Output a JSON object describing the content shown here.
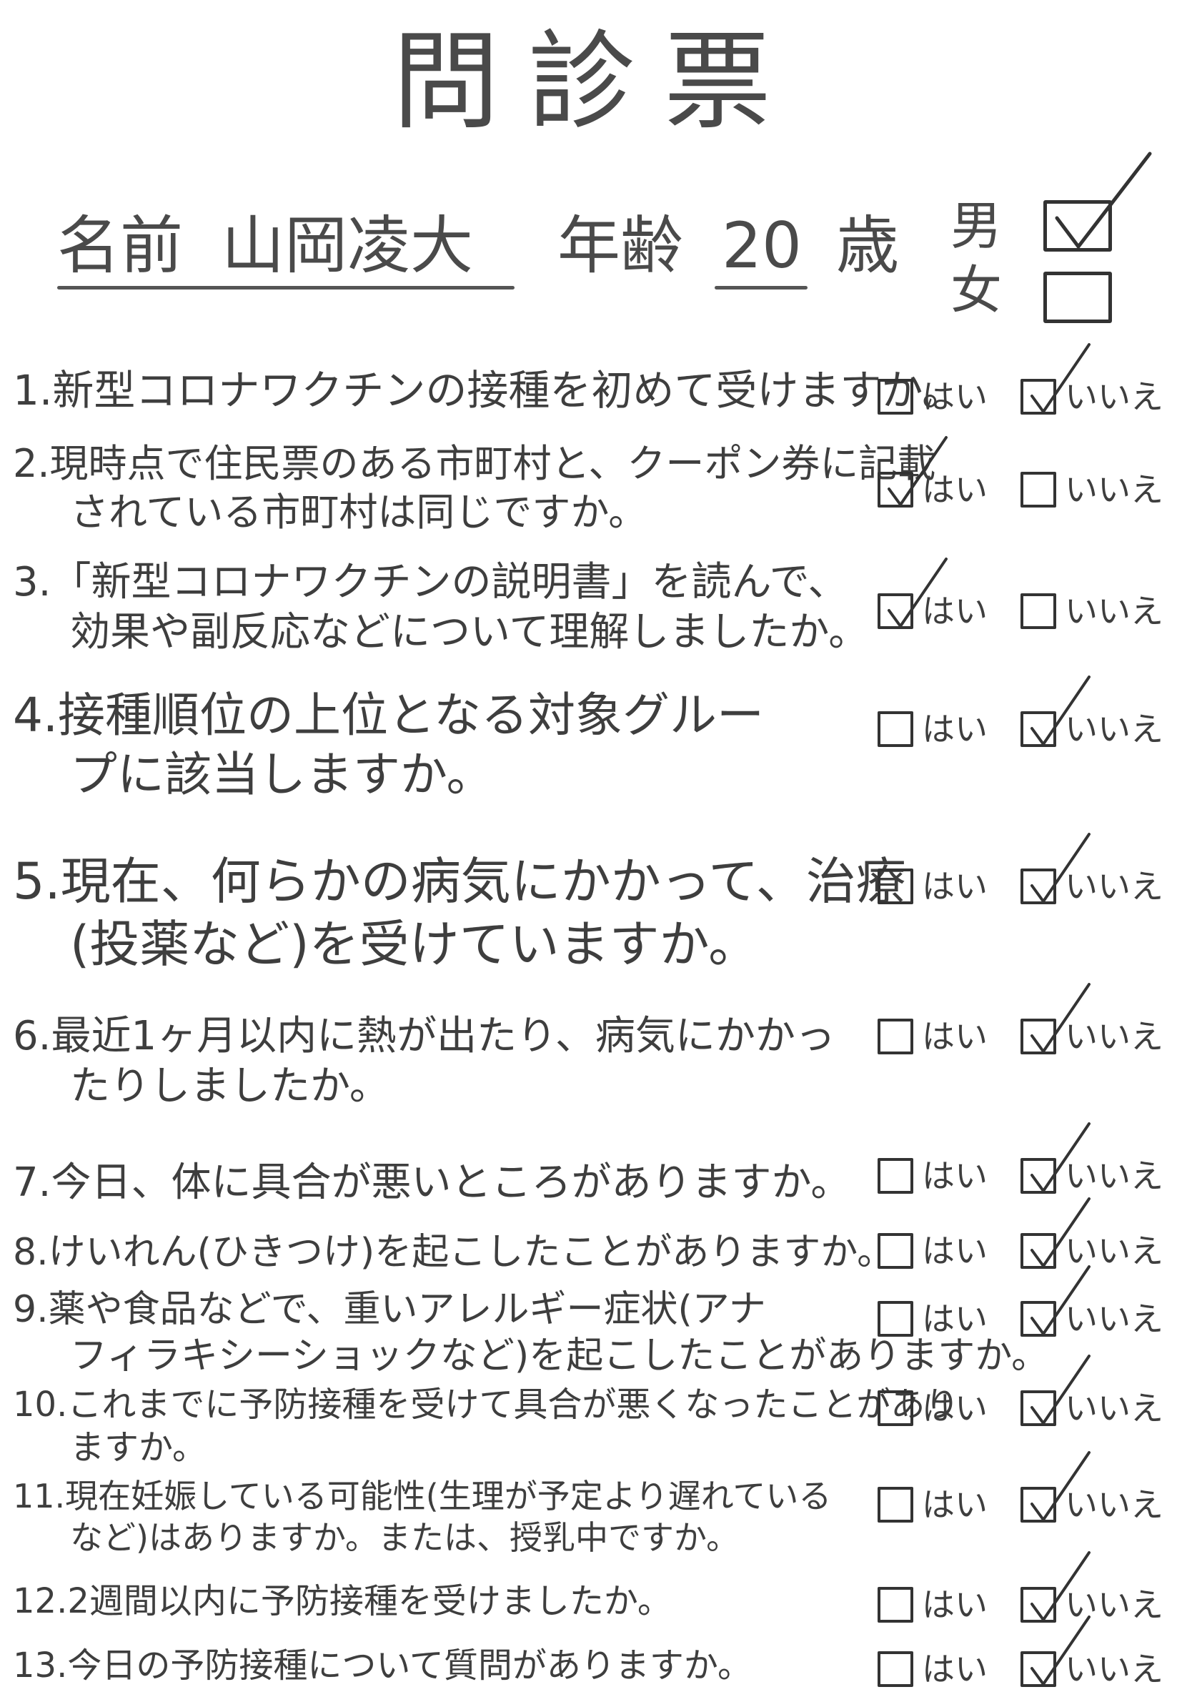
{
  "title": "問診票",
  "header": {
    "name_label": "名前",
    "name_value": "山岡凌大",
    "age_label": "年齢",
    "age_value": "20",
    "age_unit": "歳",
    "gender_male": "男",
    "gender_female": "女",
    "gender_selected": "male"
  },
  "option_labels": {
    "yes": "はい",
    "no": "いいえ"
  },
  "questions": [
    {
      "num": "1.",
      "line1": "新型コロナワクチンの接種を初めて受けますか。",
      "line2": "",
      "answer": "no"
    },
    {
      "num": "2.",
      "line1": "現時点で住民票のある市町村と、クーポン券に記載",
      "line2": "されている市町村は同じですか。",
      "answer": "yes"
    },
    {
      "num": "3.",
      "line1": "「新型コロナワクチンの説明書」を読んで、",
      "line2": "効果や副反応などについて理解しましたか。",
      "answer": "yes"
    },
    {
      "num": "4.",
      "line1": "接種順位の上位となる対象グルー",
      "line2": "プに該当しますか。",
      "answer": "no"
    },
    {
      "num": "5.",
      "line1": "現在、何らかの病気にかかって、治療",
      "line2": "(投薬など)を受けていますか。",
      "answer": "no"
    },
    {
      "num": "6.",
      "line1": "最近1ヶ月以内に熱が出たり、病気にかかっ",
      "line2": "たりしましたか。",
      "answer": "no"
    },
    {
      "num": "7.",
      "line1": "今日、体に具合が悪いところがありますか。",
      "line2": "",
      "answer": "no"
    },
    {
      "num": "8.",
      "line1": "けいれん(ひきつけ)を起こしたことがありますか。",
      "line2": "",
      "answer": "no"
    },
    {
      "num": "9.",
      "line1": "薬や食品などで、重いアレルギー症状(アナ",
      "line2": "フィラキシーショックなど)を起こしたことがありますか。",
      "answer": "no"
    },
    {
      "num": "10.",
      "line1": "これまでに予防接種を受けて具合が悪くなったことがあり",
      "line2": "ますか。",
      "answer": "no"
    },
    {
      "num": "11.",
      "line1": "現在妊娠している可能性(生理が予定より遅れている",
      "line2": "など)はありますか。または、授乳中ですか。",
      "answer": "no"
    },
    {
      "num": "12.",
      "line1": "2週間以内に予防接種を受けましたか。",
      "line2": "",
      "answer": "no"
    },
    {
      "num": "13.",
      "line1": "今日の予防接種について質問がありますか。",
      "line2": "",
      "answer": "no"
    }
  ]
}
